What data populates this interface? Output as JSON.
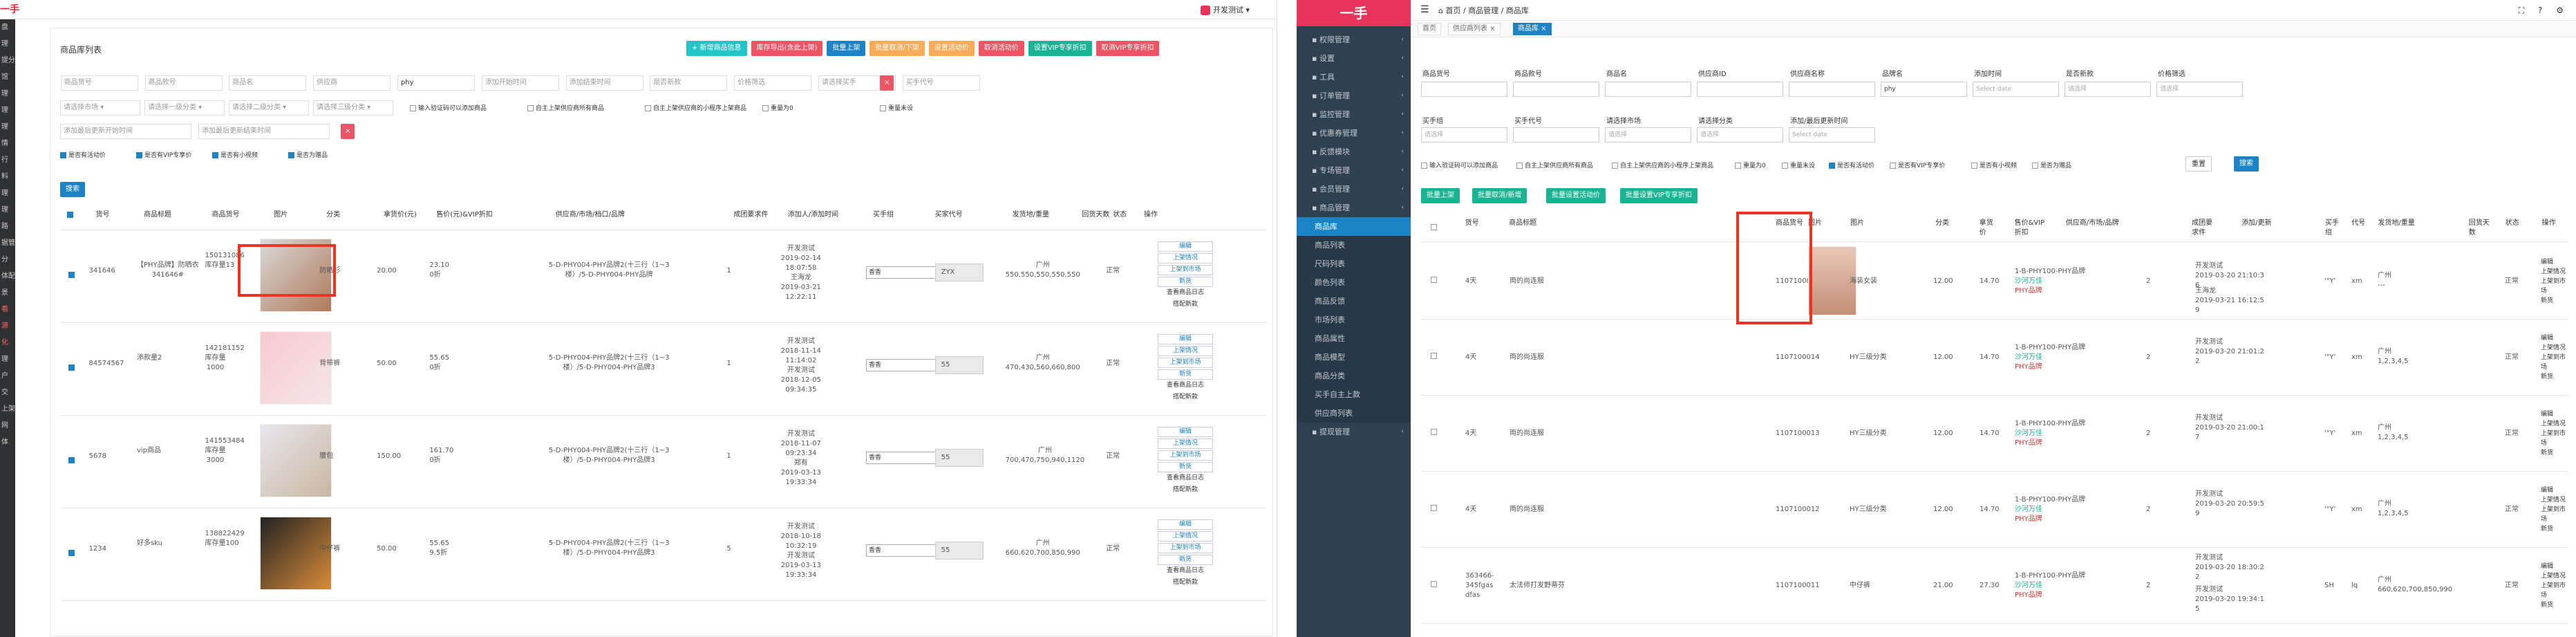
{
  "left": {
    "logo": "一手",
    "user": "开发测试",
    "side_items": [
      "盘",
      "理",
      "提分销",
      "馆",
      "理",
      "理",
      "理",
      "情",
      "行",
      "料",
      "理",
      "理",
      "路",
      "据管理",
      "分",
      "体配置",
      "景",
      "看",
      "源",
      "化",
      "理",
      "户",
      "交",
      "上架",
      "网",
      "体"
    ],
    "panel_title": "商品库列表",
    "actions": [
      {
        "label": "+ 新增商品信息",
        "color": "#23c6c8"
      },
      {
        "label": "库存导出(含此上架)",
        "color": "#ed5565"
      },
      {
        "label": "批量上架",
        "color": "#1c84c6"
      },
      {
        "label": "批量取消/下架",
        "color": "#f8ac59"
      },
      {
        "label": "设置活动价",
        "color": "#f8ac59"
      },
      {
        "label": "取消活动价",
        "color": "#ed5565"
      },
      {
        "label": "设置VIP专享折扣",
        "color": "#1ab394"
      },
      {
        "label": "取消VIP专享折扣",
        "color": "#ed5565"
      }
    ],
    "filters_row1": [
      "商品货号",
      "商品款号",
      "商品名",
      "供应商",
      "phy",
      "添加开始时间",
      "添加结束时间",
      "是否新款",
      "价格筛选",
      "请选择买手",
      "买手代号"
    ],
    "filters_row2": [
      "请选择市场",
      "请选择一级分类",
      "请选择二级分类",
      "请选择三级分类"
    ],
    "checks_row2": [
      "输入验证码可以添加商品",
      "自主上架供应商所有商品",
      "自主上架供应商的小程序上架商品",
      "重量为0",
      "重量未设"
    ],
    "filters_row3": [
      "添加最后更新开始时间",
      "添加最后更新结束时间"
    ],
    "checks_row4": [
      "是否有活动价",
      "是否有VIP专享价",
      "是否有小视频",
      "是否为赠品"
    ],
    "search_label": "搜索",
    "headers": [
      "货号",
      "商品标题",
      "商品货号",
      "图片",
      "分类",
      "拿货价(元)",
      "售价(元)&VIP折扣",
      "供应商/市场/档口/品牌",
      "成团要求件",
      "添加人/添加时间",
      "买手组",
      "买家代号",
      "发货地/重量",
      "回货天数",
      "状态",
      "操作"
    ],
    "rows": [
      {
        "sku": "341646",
        "title": "【PHY品牌】防晒衣\n341646#",
        "code": "150131086",
        "stock": "库存量13",
        "category": "防晒衫",
        "cost": "20.00",
        "price": "23.10",
        "vip": "0折",
        "supplier": "5-D-PHY004-PHY品牌2(十三行（1~3\n楼）/5-D-PHY004-PHY品牌",
        "min": "1",
        "added": "开发测试\n2019-02-14\n18:07:58\n王海龙\n2019-03-21\n12:22:11",
        "buyer": "香香",
        "code2": "ZYX",
        "ship": "广州\n550,550,550,550,550",
        "status": "正常",
        "ops": [
          "编辑",
          "上架情况",
          "上架到市场",
          "新货",
          "查看商品日志",
          "搭配新款"
        ]
      },
      {
        "sku": "84574567",
        "title": "添款量2",
        "code": "142181152",
        "stock": "库存量\n1000",
        "category": "背带裤",
        "cost": "50.00",
        "price": "55.65",
        "vip": "0折",
        "supplier": "5-D-PHY004-PHY品牌2(十三行（1~3\n楼）/5-D-PHY004-PHY品牌3",
        "min": "1",
        "added": "开发测试\n2018-11-14\n11:14:02\n开发测试\n2018-12-05\n09:34:35",
        "buyer": "香香",
        "code2": "55",
        "ship": "广州\n470,430,560,660,800",
        "status": "正常",
        "ops": [
          "编辑",
          "上架情况",
          "上架到市场",
          "新货",
          "查看商品日志",
          "搭配新款"
        ]
      },
      {
        "sku": "5678",
        "title": "vip商品",
        "code": "141553484",
        "stock": "库存量\n3000",
        "category": "腰包",
        "cost": "150.00",
        "price": "161.70",
        "vip": "0折",
        "supplier": "5-D-PHY004-PHY品牌2(十三行（1~3\n楼）/5-D-PHY004-PHY品牌3",
        "min": "1",
        "added": "开发测试\n2018-11-07\n09:23:34\n郑有\n2019-03-13\n19:33:34",
        "buyer": "香香",
        "code2": "55",
        "ship": "广州\n700,470,750,940,1120",
        "status": "正常",
        "ops": [
          "编辑",
          "上架情况",
          "上架到市场",
          "新货",
          "查看商品日志",
          "搭配新款"
        ]
      },
      {
        "sku": "1234",
        "title": "好多sku",
        "code": "138822429",
        "stock": "库存量100",
        "category": "中仔裤",
        "cost": "50.00",
        "price": "55.65",
        "vip": "9.5折",
        "supplier": "5-D-PHY004-PHY品牌2(十三行（1~3\n楼）/5-D-PHY004-PHY品牌3",
        "min": "5",
        "added": "开发测试\n2018-10-18\n10:32:19\n开发测试\n2019-03-13\n19:33:34",
        "buyer": "香香",
        "code2": "55",
        "ship": "广州\n660,620,700,850,990",
        "status": "正常",
        "ops": [
          "编辑",
          "上架情况",
          "上架到市场",
          "新货",
          "查看商品日志",
          "搭配新款"
        ]
      }
    ]
  },
  "right": {
    "logo": "一手",
    "menu": [
      {
        "label": "权限管理",
        "sub": false
      },
      {
        "label": "设置",
        "sub": false
      },
      {
        "label": "工具",
        "sub": false
      },
      {
        "label": "订单管理",
        "sub": false
      },
      {
        "label": "监控管理",
        "sub": false
      },
      {
        "label": "优惠券管理",
        "sub": false
      },
      {
        "label": "反馈模块",
        "sub": false
      },
      {
        "label": "专场管理",
        "sub": false
      },
      {
        "label": "会员管理",
        "sub": false
      },
      {
        "label": "商品管理",
        "sub": false
      },
      {
        "label": "商品库",
        "sub": true,
        "active": true
      },
      {
        "label": "商品列表",
        "sub": true
      },
      {
        "label": "尺码列表",
        "sub": true
      },
      {
        "label": "颜色列表",
        "sub": true
      },
      {
        "label": "商品反馈",
        "sub": true
      },
      {
        "label": "市场列表",
        "sub": true
      },
      {
        "label": "商品属性",
        "sub": true
      },
      {
        "label": "商品模型",
        "sub": true
      },
      {
        "label": "商品分类",
        "sub": true
      },
      {
        "label": "买手自主上款",
        "sub": true
      },
      {
        "label": "供应商列表",
        "sub": true
      },
      {
        "label": "提现管理",
        "sub": false
      }
    ],
    "breadcrumb": "首页  /  商品管理  /  商品库",
    "tabs": [
      "首页",
      "供应商列表 ×",
      "商品库 ×"
    ],
    "labels1": [
      "商品货号",
      "商品款号",
      "商品名",
      "供应商ID",
      "供应商名称",
      "品牌名",
      "添加时间",
      "是否新款",
      "价格筛选"
    ],
    "inputs1": [
      "",
      "",
      "",
      "",
      "",
      "phy",
      "Select date",
      "请选择",
      "请选择"
    ],
    "labels2": [
      "买手组",
      "买手代号",
      "请选择市场",
      "请选择分类",
      "添加/最后更新时间"
    ],
    "inputs2": [
      "请选择",
      "",
      "请选择",
      "请选择",
      "Select date"
    ],
    "checks": [
      "输入验证码可以添加商品",
      "自主上架供应商所有商品",
      "自主上架供应商的小程序上架商品",
      "重量为0",
      "重量未设",
      "是否有活动价",
      "是否有VIP专享价",
      "是否有小视频",
      "是否为赠品"
    ],
    "reset": "重置",
    "search": "搜索",
    "actions": [
      "批量上架",
      "批量取消/新增",
      "批量设置活动价",
      "批量设置VIP专享折扣"
    ],
    "headers": [
      "货号",
      "商品标题",
      "商品货号",
      "图片",
      "分类",
      "拿货\n价",
      "售价&VIP\n折扣",
      "供应商/市场/品牌",
      "成团要\n求件",
      "添加/更新",
      "买手\n组",
      "代号",
      "发货地/重量",
      "回货天\n数",
      "状态",
      "操作"
    ],
    "rows": [
      {
        "sku": "4天",
        "title": "両的尚连服",
        "code": "1107100015",
        "cat": "海装女装",
        "cost": "12.00",
        "price": "14.70",
        "sup": "1-B-PHY100-PHY品牌\n沙河万佳\nPHY品牌",
        "min": "2",
        "add": "开发测试\n2019-03-20 21:10:3\n6",
        "add2": "王海龙\n2019-03-21 16:12:5\n9",
        "buyer": "'\"Y'",
        "code2": "xm",
        "ship": "广州\n---",
        "status": "正常",
        "ops": [
          "编辑",
          "上架情况",
          "上架到市场",
          "新货"
        ]
      },
      {
        "sku": "4天",
        "title": "両的尚连服",
        "code": "1107100014",
        "cat": "HY三级分类",
        "cost": "12.00",
        "price": "14.70",
        "sup": "1-B-PHY100-PHY品牌\n沙河万佳\nPHY品牌",
        "min": "2",
        "add": "开发测试\n2019-03-20 21:01:2\n2",
        "add2": "",
        "buyer": "'\"Y'",
        "code2": "xm",
        "ship": "广州\n1,2,3,4,5",
        "status": "正常",
        "ops": [
          "编辑",
          "上架情况",
          "上架到市场",
          "新货"
        ]
      },
      {
        "sku": "4天",
        "title": "両的尚连服",
        "code": "1107100013",
        "cat": "HY三级分类",
        "cost": "12.00",
        "price": "14.70",
        "sup": "1-B-PHY100-PHY品牌\n沙河万佳\nPHY品牌",
        "min": "2",
        "add": "开发测试\n2019-03-20 21:00:1\n7",
        "add2": "",
        "buyer": "'\"Y'",
        "code2": "xm",
        "ship": "广州\n1,2,3,4,5",
        "status": "正常",
        "ops": [
          "编辑",
          "上架情况",
          "上架到市场",
          "新货"
        ]
      },
      {
        "sku": "4天",
        "title": "両的尚连服",
        "code": "1107100012",
        "cat": "HY三级分类",
        "cost": "12.00",
        "price": "14.70",
        "sup": "1-B-PHY100-PHY品牌\n沙河万佳\nPHY品牌",
        "min": "2",
        "add": "开发测试\n2019-03-20 20:59:5\n9",
        "add2": "",
        "buyer": "'\"Y'",
        "code2": "xm",
        "ship": "广州\n1,2,3,4,5",
        "status": "正常",
        "ops": [
          "编辑",
          "上架情况",
          "上架到市场",
          "新货"
        ]
      },
      {
        "sku": "363466-\n345fgas\ndfas",
        "title": "太法师打发野蒂芬",
        "code": "1107100011",
        "cat": "中仔裤",
        "cost": "21.00",
        "price": "27.30",
        "sup": "1-B-PHY100-PHY品牌\n沙河万佳\nPHY品牌",
        "min": "2",
        "add": "开发测试\n2019-03-20 18:30:2\n2",
        "add2": "开发测试\n2019-03-20 19:34:1\n5",
        "buyer": "SH",
        "code2": "lq",
        "ship": "广州\n660,620,700,850,990",
        "status": "正常",
        "ops": [
          "编辑",
          "上架情况",
          "上架到市场",
          "新货"
        ]
      }
    ]
  }
}
